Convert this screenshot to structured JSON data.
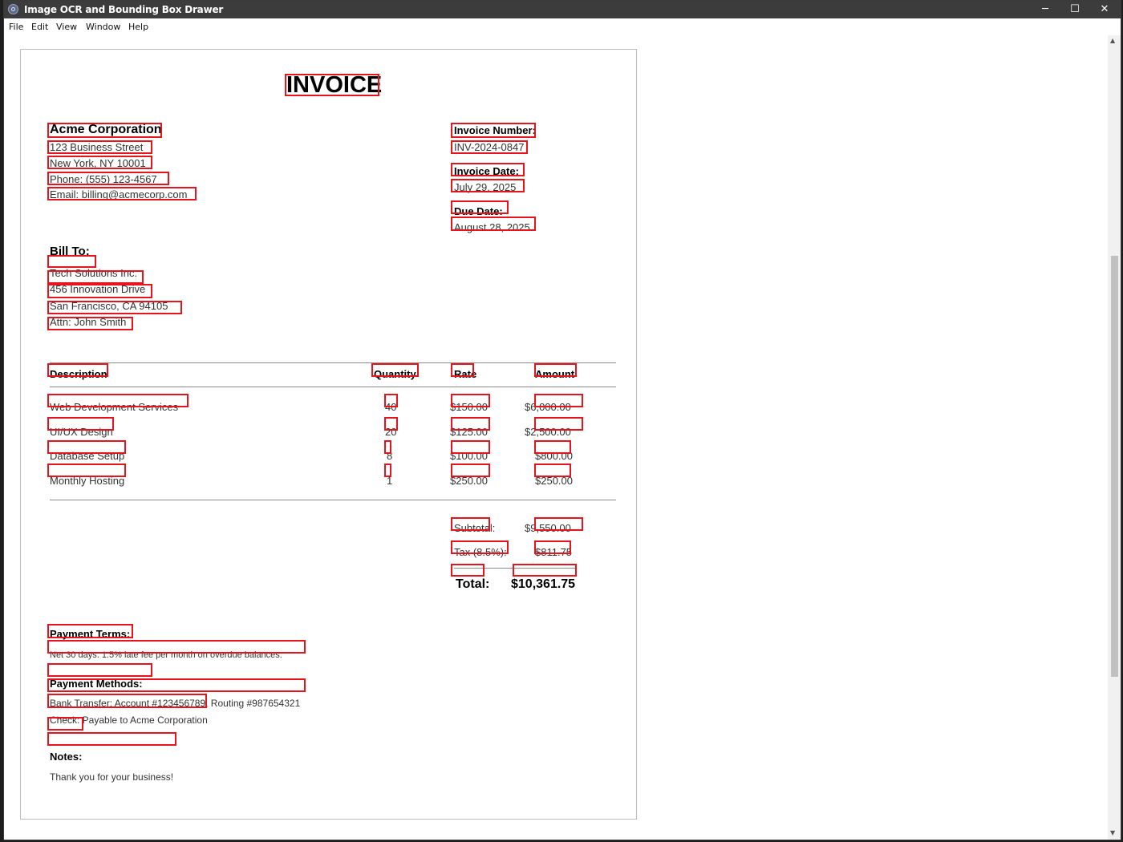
{
  "window": {
    "title": "Image OCR and Bounding Box Drawer",
    "minimize_icon": "minimize-icon",
    "maximize_icon": "maximize-icon",
    "close_icon": "close-icon"
  },
  "menu": [
    "File",
    "Edit",
    "View",
    "Window",
    "Help"
  ],
  "invoice": {
    "heading": "INVOICE",
    "company": {
      "name": "Acme Corporation",
      "street": "123 Business Street",
      "city": "New York, NY 10001",
      "phone": "Phone: (555) 123-4567",
      "email": "Email: billing@acmecorp.com"
    },
    "meta": {
      "number_label": "Invoice Number:",
      "number": "INV-2024-0847",
      "date_label": "Invoice Date:",
      "date": "July 29, 2025",
      "due_label": "Due Date:",
      "due": "August 28, 2025"
    },
    "bill_to": {
      "label": "Bill To:",
      "company": "Tech Solutions Inc.",
      "street": "456 Innovation Drive",
      "city": "San Francisco, CA 94105",
      "attn": "Attn: John Smith"
    },
    "table": {
      "headers": [
        "Description",
        "Quantity",
        "Rate",
        "Amount"
      ],
      "rows": [
        [
          "Web Development Services",
          "40",
          "$150.00",
          "$6,000.00"
        ],
        [
          "UI/UX Design",
          "20",
          "$125.00",
          "$2,500.00"
        ],
        [
          "Database Setup",
          "8",
          "$100.00",
          "$800.00"
        ],
        [
          "Monthly Hosting",
          "1",
          "$250.00",
          "$250.00"
        ]
      ]
    },
    "totals": {
      "subtotal_label": "Subtotal:",
      "subtotal": "$9,550.00",
      "tax_label": "Tax (8.5%):",
      "tax": "$811.75",
      "total_label": "Total:",
      "total": "$10,361.75"
    },
    "payment_terms": {
      "label": "Payment Terms:",
      "text": "Net 30 days. 1.5% late fee per month on overdue balances."
    },
    "payment_methods": {
      "label": "Payment Methods:",
      "bank": "Bank Transfer: Account #123456789, Routing #987654321",
      "check": "Check: Payable to Acme Corporation"
    },
    "notes": {
      "label": "Notes:",
      "text": "Thank you for your business!"
    }
  },
  "colors": {
    "bounding_box": "#e8141b",
    "titlebar": "#3c3c3c"
  }
}
